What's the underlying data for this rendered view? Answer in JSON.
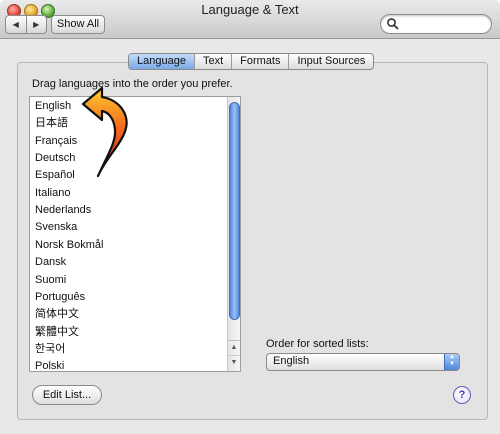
{
  "window": {
    "title": "Language & Text"
  },
  "toolbar": {
    "show_all": "Show All"
  },
  "tabs": [
    {
      "label": "Language"
    },
    {
      "label": "Text"
    },
    {
      "label": "Formats"
    },
    {
      "label": "Input Sources"
    }
  ],
  "active_tab": "Language",
  "instruction": "Drag languages into the order you prefer.",
  "languages": [
    "English",
    "日本語",
    "Français",
    "Deutsch",
    "Español",
    "Italiano",
    "Nederlands",
    "Svenska",
    "Norsk Bokmål",
    "Dansk",
    "Suomi",
    "Português",
    "简体中文",
    "繁體中文",
    "한국어",
    "Polski"
  ],
  "sorted_lists": {
    "label": "Order for sorted lists:",
    "value": "English"
  },
  "edit_list": "Edit List...",
  "help": "?",
  "colors": {
    "accent": "#4f86d9",
    "annotation_arrow": "#e63b1f"
  }
}
